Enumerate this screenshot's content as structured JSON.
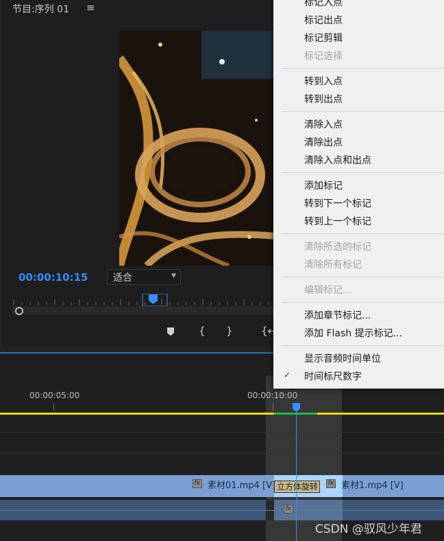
{
  "monitor": {
    "title": "节目:序列 01",
    "menu_icon": "≡",
    "timecode": "00:00:10:15",
    "fit_label": "适合",
    "controls": {
      "marker_icon": "marker-icon",
      "in_icon": "{",
      "out_icon": "}",
      "go_in_icon": "{←"
    }
  },
  "timeline": {
    "time_labels": [
      "00:00:05:00",
      "00:00:10:00"
    ],
    "clips": {
      "v1_left": "素材01.mp4 [V]",
      "transition": "立方体旋转",
      "v1_right": "素材1.mp4 [V]",
      "fx": "fx"
    }
  },
  "watermark": "CSDN @驭风少年君",
  "context_menu": {
    "groups": [
      [
        {
          "label": "标记入点",
          "enabled": true
        },
        {
          "label": "标记出点",
          "enabled": true
        },
        {
          "label": "标记剪辑",
          "enabled": true
        },
        {
          "label": "标记选择",
          "enabled": false
        }
      ],
      [
        {
          "label": "转到入点",
          "enabled": true
        },
        {
          "label": "转到出点",
          "enabled": true
        }
      ],
      [
        {
          "label": "清除入点",
          "enabled": true
        },
        {
          "label": "清除出点",
          "enabled": true
        },
        {
          "label": "清除入点和出点",
          "enabled": true
        }
      ],
      [
        {
          "label": "添加标记",
          "enabled": true
        },
        {
          "label": "转到下一个标记",
          "enabled": true
        },
        {
          "label": "转到上一个标记",
          "enabled": true
        }
      ],
      [
        {
          "label": "清除所选的标记",
          "enabled": false
        },
        {
          "label": "清除所有标记",
          "enabled": false
        }
      ],
      [
        {
          "label": "编辑标记...",
          "enabled": false
        }
      ],
      [
        {
          "label": "添加章节标记...",
          "enabled": true
        },
        {
          "label": "添加 Flash 提示标记...",
          "enabled": true
        }
      ],
      [
        {
          "label": "显示音频时间单位",
          "enabled": true
        },
        {
          "label": "时间标尺数字",
          "enabled": true,
          "checked": true
        }
      ]
    ]
  },
  "colors": {
    "timecode": "#2f8dff",
    "work_area": "#e9e100",
    "rendered": "#1fbf3f",
    "playhead": "#3a8dff"
  }
}
